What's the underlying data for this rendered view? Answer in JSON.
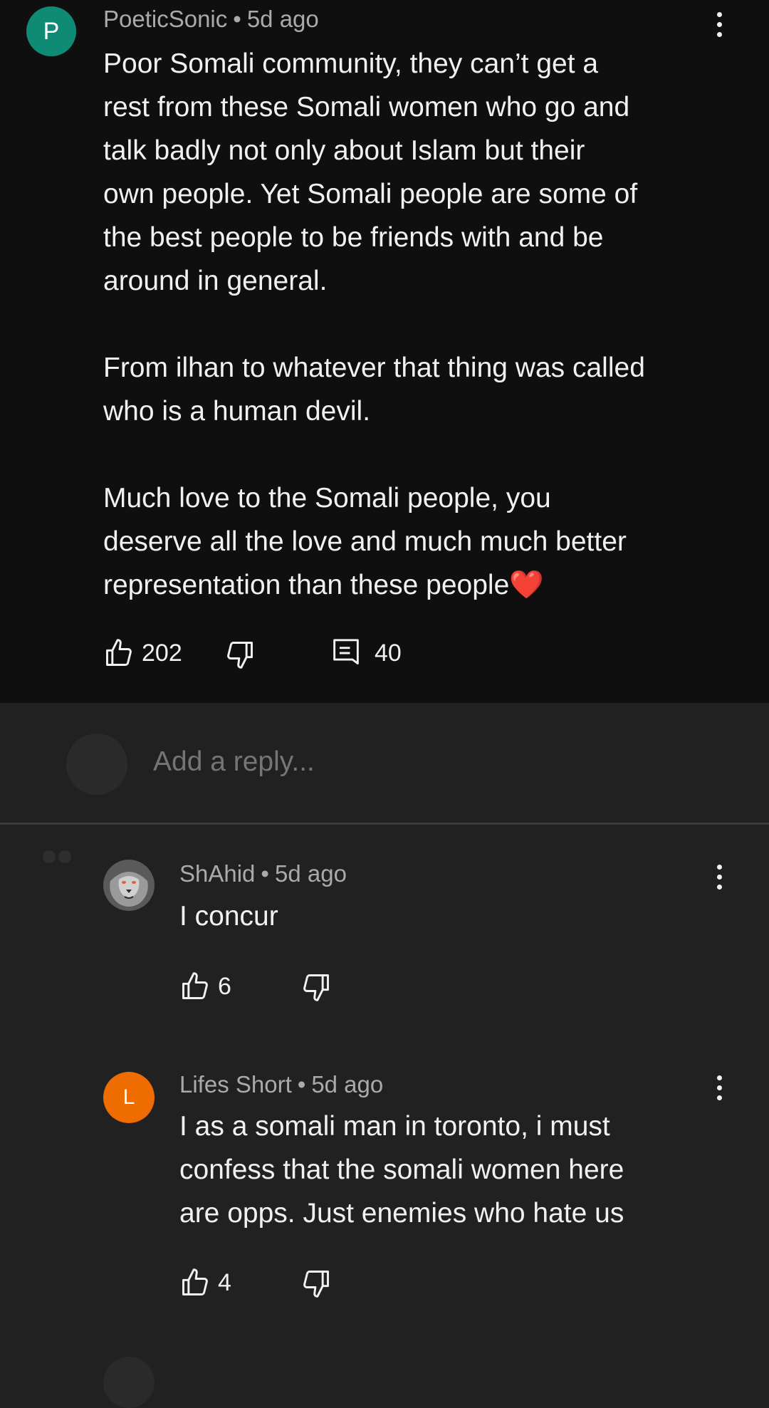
{
  "top_comment": {
    "avatar_letter": "P",
    "avatar_color": "#0f8a74",
    "author": "PoeticSonic",
    "separator": "•",
    "time": "5d ago",
    "text": "Poor Somali community, they can’t get a\nrest from these Somali women who go and\ntalk badly not only about Islam but their\nown people. Yet Somali people are some of\nthe best people to be friends with and be\naround in general.\n\nFrom ilhan to whatever that thing was called\nwho is a human devil.\n\nMuch love to the Somali people, you\ndeserve all the love and much much better\nrepresentation than these people❤️",
    "likes": "202",
    "replies": "40"
  },
  "reply_box": {
    "placeholder": "Add a reply..."
  },
  "replies": [
    {
      "avatar_icon": "lion-avatar",
      "author": "ShAhid",
      "separator": "•",
      "time": "5d ago",
      "text": "I concur",
      "likes": "6"
    },
    {
      "avatar_letter": "L",
      "avatar_color": "#ef6c00",
      "author": "Lifes Short",
      "separator": "•",
      "time": "5d ago",
      "text": "I as a somali man in toronto, i must\nconfess that the somali women here\nare opps. Just enemies who hate us",
      "likes": "4"
    }
  ],
  "colors": {
    "top_background": "#0f0f0f",
    "reply_background": "#212121",
    "text_primary": "#f1f1f1",
    "text_secondary": "#aaaaaa"
  }
}
